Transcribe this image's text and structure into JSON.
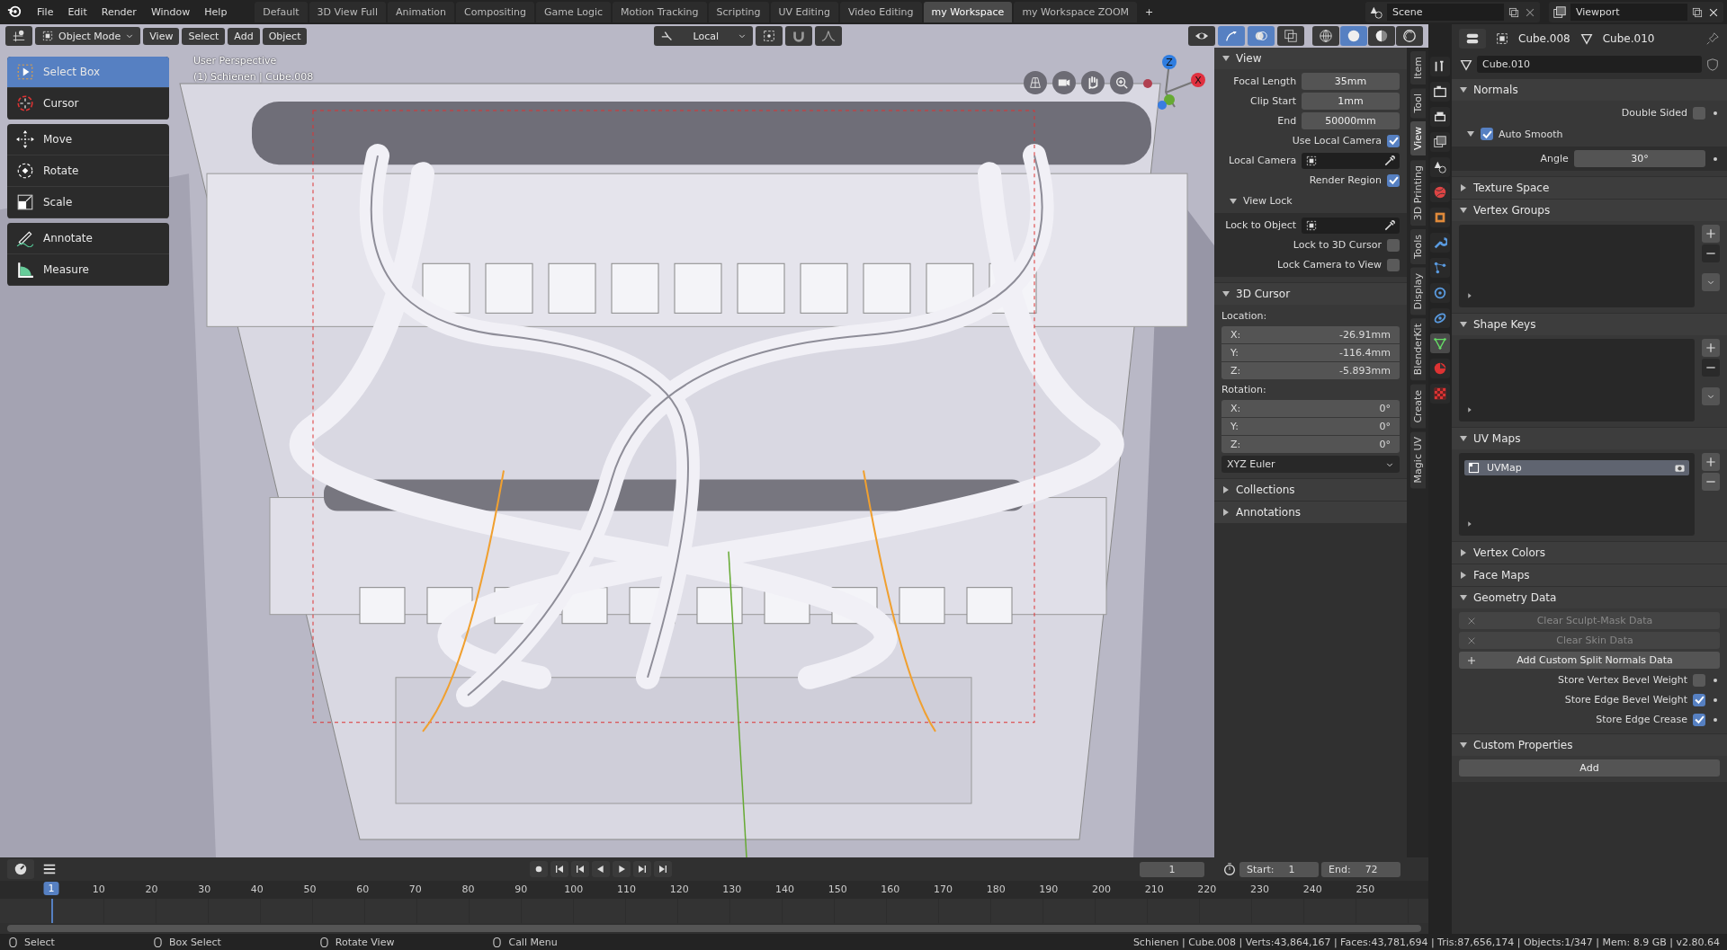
{
  "menu": [
    "File",
    "Edit",
    "Render",
    "Window",
    "Help"
  ],
  "workspaces": [
    {
      "label": "Default",
      "selected": false
    },
    {
      "label": "3D View Full",
      "selected": false
    },
    {
      "label": "Animation",
      "selected": false
    },
    {
      "label": "Compositing",
      "selected": false
    },
    {
      "label": "Game Logic",
      "selected": false
    },
    {
      "label": "Motion Tracking",
      "selected": false
    },
    {
      "label": "Scripting",
      "selected": false
    },
    {
      "label": "UV Editing",
      "selected": false
    },
    {
      "label": "Video Editing",
      "selected": false
    },
    {
      "label": "my Workspace",
      "selected": true
    },
    {
      "label": "my Workspace ZOOM",
      "selected": false
    }
  ],
  "add_tab": "+",
  "scene": "Scene",
  "view_layer": "Viewport",
  "viewport_header": {
    "mode": "Object Mode",
    "menus": [
      "View",
      "Select",
      "Add",
      "Object"
    ],
    "orientation": "Local",
    "toggles": [
      {
        "kind": "gizmo",
        "selected": true
      },
      {
        "kind": "overlay",
        "selected": true
      },
      {
        "kind": "xray",
        "selected": false
      }
    ],
    "shading": [
      {
        "kind": "wireframe",
        "selected": false
      },
      {
        "kind": "solid",
        "selected": true
      },
      {
        "kind": "material",
        "selected": false
      },
      {
        "kind": "rendered",
        "selected": false
      }
    ]
  },
  "tool_groups": [
    {
      "tools": [
        {
          "label": "Select Box",
          "kind": "select",
          "selected": true
        },
        {
          "label": "Cursor",
          "kind": "cursor",
          "selected": false
        }
      ]
    },
    {
      "tools": [
        {
          "label": "Move",
          "kind": "move",
          "selected": false
        },
        {
          "label": "Rotate",
          "kind": "rotate",
          "selected": false
        },
        {
          "label": "Scale",
          "kind": "scale",
          "selected": false
        }
      ]
    },
    {
      "tools": [
        {
          "label": "Annotate",
          "kind": "annotate",
          "selected": false
        },
        {
          "label": "Measure",
          "kind": "measure",
          "selected": false
        }
      ]
    }
  ],
  "overlay": {
    "view_name": "User Perspective",
    "object_info": "(1) Schienen | Cube.008"
  },
  "gizmo": {
    "axes": [
      {
        "label": "Z",
        "color": "#2f7de0"
      },
      {
        "label": "X",
        "color": "#e0303f"
      }
    ]
  },
  "sidebar": {
    "tabs": [
      {
        "label": "Item",
        "selected": false
      },
      {
        "label": "Tool",
        "selected": false
      },
      {
        "label": "View",
        "selected": true
      },
      {
        "label": "3D Printing",
        "selected": false
      },
      {
        "label": "Tools",
        "selected": false
      },
      {
        "label": "Display",
        "selected": false
      },
      {
        "label": "BlenderKit",
        "selected": false
      },
      {
        "label": "Create",
        "selected": false
      },
      {
        "label": "Magic UV",
        "selected": false
      }
    ],
    "panels": [
      {
        "title": "View",
        "expanded": true,
        "rows": [
          {
            "kind": "field",
            "label": "Focal Length",
            "value": "35mm"
          },
          {
            "kind": "field",
            "label": "Clip Start",
            "value": "1mm"
          },
          {
            "kind": "field",
            "label": "End",
            "value": "50000mm"
          },
          {
            "kind": "checkbox",
            "label": "Use Local Camera",
            "checked": true
          },
          {
            "kind": "object",
            "label": "Local Camera"
          },
          {
            "kind": "checkbox",
            "label": "Render Region",
            "checked": true
          },
          {
            "kind": "subpanel",
            "title": "View Lock",
            "expanded": true,
            "rows": [
              {
                "kind": "object",
                "label": "Lock to Object"
              },
              {
                "kind": "checkbox",
                "label": "Lock to 3D Cursor",
                "checked": false
              },
              {
                "kind": "checkbox",
                "label": "Lock Camera to View",
                "checked": false
              }
            ]
          }
        ]
      },
      {
        "title": "3D Cursor",
        "expanded": true,
        "rows": [
          {
            "kind": "label",
            "label": "Location:"
          },
          {
            "kind": "vector",
            "items": [
              {
                "axis": "X:",
                "value": "-26.91mm"
              },
              {
                "axis": "Y:",
                "value": "-116.4mm"
              },
              {
                "axis": "Z:",
                "value": "-5.893mm"
              }
            ]
          },
          {
            "kind": "label",
            "label": "Rotation:"
          },
          {
            "kind": "vector",
            "items": [
              {
                "axis": "X:",
                "value": "0°"
              },
              {
                "axis": "Y:",
                "value": "0°"
              },
              {
                "axis": "Z:",
                "value": "0°"
              }
            ]
          },
          {
            "kind": "dropdown",
            "value": "XYZ Euler"
          }
        ]
      },
      {
        "title": "Collections",
        "expanded": false
      },
      {
        "title": "Annotations",
        "expanded": false
      }
    ]
  },
  "properties": {
    "object": "Cube.008",
    "data": "Cube.010",
    "datablock": "Cube.010",
    "nav": [
      {
        "kind": "tool",
        "selected": false
      },
      {
        "kind": "render",
        "selected": false
      },
      {
        "kind": "output",
        "selected": false
      },
      {
        "kind": "view-layer",
        "selected": false
      },
      {
        "kind": "scene",
        "selected": false
      },
      {
        "kind": "world",
        "selected": false
      },
      {
        "kind": "object",
        "selected": false
      },
      {
        "kind": "modifier",
        "selected": false
      },
      {
        "kind": "particles",
        "selected": false
      },
      {
        "kind": "physics",
        "selected": false
      },
      {
        "kind": "constraint",
        "selected": false
      },
      {
        "kind": "mesh",
        "selected": true
      },
      {
        "kind": "material",
        "selected": false
      },
      {
        "kind": "texture",
        "selected": false
      }
    ],
    "panels": [
      {
        "title": "Normals",
        "expanded": true,
        "rows": [
          {
            "kind": "checkbox",
            "label": "Double Sided",
            "checked": false
          },
          {
            "kind": "subpanel-check",
            "title": "Auto Smooth",
            "expanded": true,
            "checked": true,
            "rows": [
              {
                "kind": "field",
                "label": "Angle",
                "value": "30°"
              }
            ]
          }
        ]
      },
      {
        "title": "Texture Space",
        "expanded": false
      },
      {
        "title": "Vertex Groups",
        "expanded": true,
        "rows": [
          {
            "kind": "list-menu"
          }
        ]
      },
      {
        "title": "Shape Keys",
        "expanded": true,
        "rows": [
          {
            "kind": "list-menu"
          }
        ]
      },
      {
        "title": "UV Maps",
        "expanded": true,
        "rows": [
          {
            "kind": "list",
            "items": [
              {
                "label": "UVMap",
                "selected": true
              }
            ]
          }
        ]
      },
      {
        "title": "Vertex Colors",
        "expanded": false
      },
      {
        "title": "Face Maps",
        "expanded": false
      },
      {
        "title": "Geometry Data",
        "expanded": true,
        "rows": [
          {
            "kind": "clear-button",
            "label": "Clear Sculpt-Mask Data",
            "disabled": true
          },
          {
            "kind": "clear-button",
            "label": "Clear Skin Data",
            "disabled": true
          },
          {
            "kind": "add-button",
            "label": "Add Custom Split Normals Data",
            "disabled": false
          },
          {
            "kind": "checkbox",
            "label": "Store Vertex Bevel Weight",
            "checked": false
          },
          {
            "kind": "checkbox",
            "label": "Store Edge Bevel Weight",
            "checked": true
          },
          {
            "kind": "checkbox",
            "label": "Store Edge Crease",
            "checked": true
          }
        ]
      },
      {
        "title": "Custom Properties",
        "expanded": true,
        "rows": [
          {
            "kind": "button",
            "label": "Add",
            "disabled": false
          }
        ]
      }
    ]
  },
  "timeline": {
    "current_frame": "1",
    "start_label": "Start:",
    "start": "1",
    "end_label": "End:",
    "end": "72",
    "ruler": [
      "10",
      "20",
      "30",
      "40",
      "50",
      "60",
      "70",
      "80",
      "90",
      "100",
      "110",
      "120",
      "130",
      "140",
      "150",
      "160",
      "170",
      "180",
      "190",
      "200",
      "210",
      "220",
      "230",
      "240",
      "250"
    ],
    "playhead": "1"
  },
  "status_bar": {
    "hints": [
      {
        "label": "Select"
      },
      {
        "label": "Box Select"
      },
      {
        "label": "Rotate View"
      },
      {
        "label": "Call Menu"
      }
    ],
    "stats": "Schienen | Cube.008 | Verts:43,864,167 | Faces:43,781,694 | Tris:87,656,174 | Objects:1/347 | Mem: 8.9 GB | v2.80.64"
  }
}
